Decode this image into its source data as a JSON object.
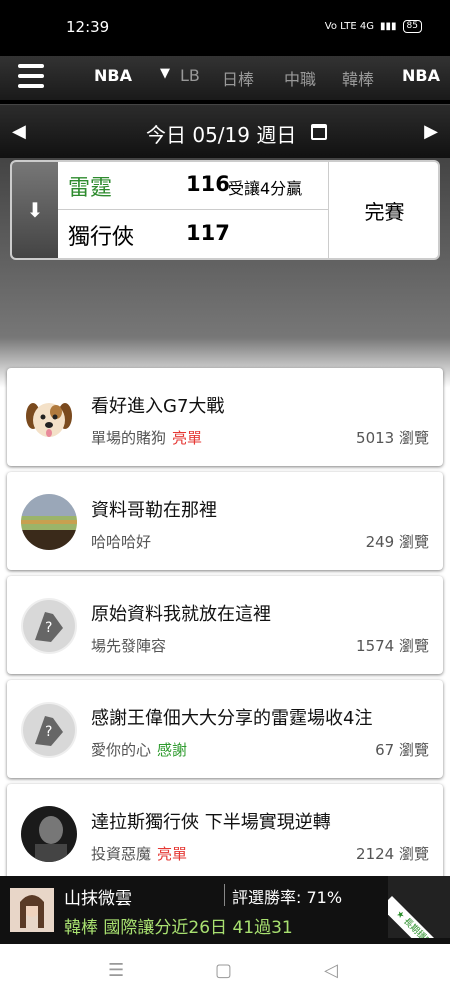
{
  "status_bar": {
    "time": "12:39",
    "indicators": "Vo LTE 4G",
    "battery": "85"
  },
  "nav": {
    "league_selected": "NBA",
    "tabs": [
      "LB",
      "日棒",
      "中職",
      "韓棒",
      "NBA"
    ],
    "active_tab": 4,
    "icons": {
      "menu": "hamburger-menu-icon",
      "dropdown": "caret-down-icon"
    }
  },
  "date_bar": {
    "label": "今日 05/19 週日",
    "prev": "◀",
    "next": "▶",
    "calendar_icon": "calendar-icon"
  },
  "game": {
    "team1": {
      "name": "雷霆",
      "score": "116",
      "handicap": "受讓4分贏",
      "color": "#2e8b2e"
    },
    "team2": {
      "name": "獨行俠",
      "score": "117",
      "color": "#111111"
    },
    "status": "完賽",
    "expand_icon": "arrow-down-icon"
  },
  "posts": [
    {
      "title": "看好進入G7大戰",
      "author": "單場的賭狗",
      "tag": "亮單",
      "tag_color": "#e53935",
      "views": "5013 瀏覽",
      "avatar": "dog-emoji"
    },
    {
      "title": "資料哥勒在那裡",
      "author": "哈哈哈好",
      "tag": "",
      "tag_color": "",
      "views": "249 瀏覽",
      "avatar": "landscape-photo"
    },
    {
      "title": "原始資料我就放在這裡",
      "author": "場先發陣容",
      "tag": "",
      "tag_color": "",
      "views": "1574 瀏覽",
      "avatar": "default-avatar"
    },
    {
      "title": "感謝王偉佃大大分享的雷霆場收4注",
      "author": "愛你的心",
      "tag": "感謝",
      "tag_color": "#2e9b2e",
      "views": "67 瀏覽",
      "avatar": "default-avatar"
    },
    {
      "title": "達拉斯獨行俠 下半場實現逆轉",
      "author": "投資惡魔",
      "tag": "亮單",
      "tag_color": "#e53935",
      "views": "2124 瀏覽",
      "avatar": "portrait-photo"
    }
  ],
  "tipster": {
    "name": "山抹微雲",
    "win_rate": "評選勝率: 71%",
    "record": "韓棒 國際讓分近26日 41過31",
    "badge": "★ 長期穩定 ★"
  },
  "android_nav": {
    "recent": "☰",
    "home": "▢",
    "back": "◁"
  }
}
